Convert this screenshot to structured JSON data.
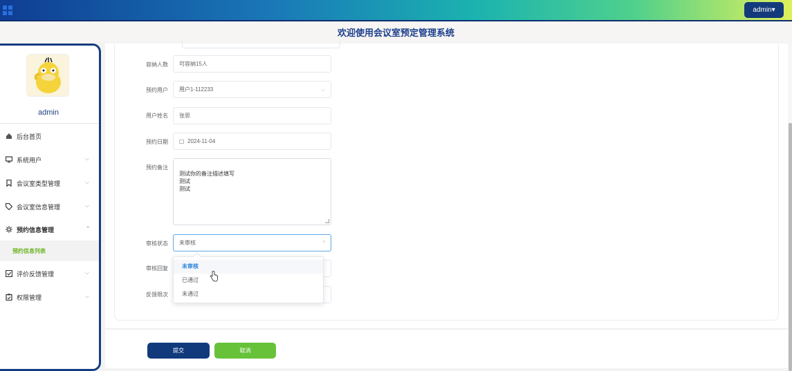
{
  "header": {
    "user_menu_label": "admin▾"
  },
  "page_title": "欢迎使用会议室预定管理系统",
  "sidebar": {
    "username": "admin",
    "items": [
      {
        "label": "后台首页",
        "icon": "home-icon"
      },
      {
        "label": "系统用户",
        "icon": "monitor-icon",
        "chevron": "⌵"
      },
      {
        "label": "会议室类型管理",
        "icon": "bookmark-icon",
        "chevron": "⌵"
      },
      {
        "label": "会议室信息管理",
        "icon": "tag-icon",
        "chevron": "⌵"
      },
      {
        "label": "预约信息管理",
        "icon": "gear-icon",
        "chevron": "^"
      },
      {
        "label": "评价反馈管理",
        "icon": "checkbox-icon",
        "chevron": "⌵"
      },
      {
        "label": "权限管理",
        "icon": "clipboard-icon",
        "chevron": "⌵"
      }
    ],
    "active_sub_item": "预约信息列表"
  },
  "form": {
    "capacity": {
      "label": "容纳人数",
      "value": "可容纳15人"
    },
    "booking_user": {
      "label": "预约用户",
      "value": "用户1-112233",
      "chevron": "⌵"
    },
    "user_name": {
      "label": "用户姓名",
      "value": "张思"
    },
    "booking_date": {
      "label": "预约日期",
      "value": "2024-11-04"
    },
    "booking_note": {
      "label": "预约备注",
      "value": "测试你的备注描述填写\n测试\n测试"
    },
    "review_status": {
      "label": "审核状态",
      "value": "未审核",
      "chevron": "^"
    },
    "review_reply": {
      "label": "审核回复"
    },
    "feedback_count": {
      "label": "反馈限次"
    }
  },
  "dropdown": {
    "options": [
      "未审核",
      "已通过",
      "未通过"
    ],
    "selected": "未审核"
  },
  "buttons": {
    "submit": "提交",
    "cancel": "取消"
  },
  "colors": {
    "brand_navy": "#113a7c",
    "accent_green": "#67c23a",
    "link_blue": "#2a82d8"
  }
}
